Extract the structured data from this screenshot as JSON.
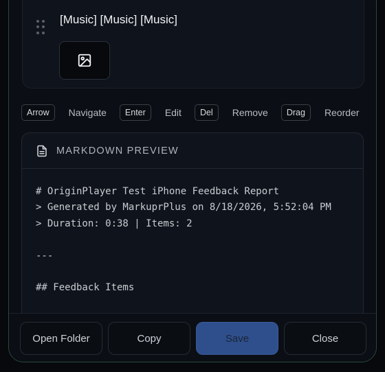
{
  "item": {
    "text": "[Music] [Music] [Music]",
    "thumbnail_icon": "image-icon"
  },
  "shortcuts": [
    {
      "key": "Arrow",
      "label": "Navigate"
    },
    {
      "key": "Enter",
      "label": "Edit"
    },
    {
      "key": "Del",
      "label": "Remove"
    },
    {
      "key": "Drag",
      "label": "Reorder"
    }
  ],
  "preview": {
    "title": "MARKDOWN PREVIEW",
    "icon": "document-icon",
    "content": "# OriginPlayer Test iPhone Feedback Report\n> Generated by MarkuprPlus on 8/18/2026, 5:52:04 PM\n> Duration: 0:38 | Items: 2\n\n---\n\n## Feedback Items"
  },
  "footer": {
    "open_folder": "Open Folder",
    "copy": "Copy",
    "save": "Save",
    "close": "Close"
  },
  "colors": {
    "accent": "#2f4f8c",
    "frame_border": "#2a4a3a",
    "background": "#0b0e14"
  }
}
